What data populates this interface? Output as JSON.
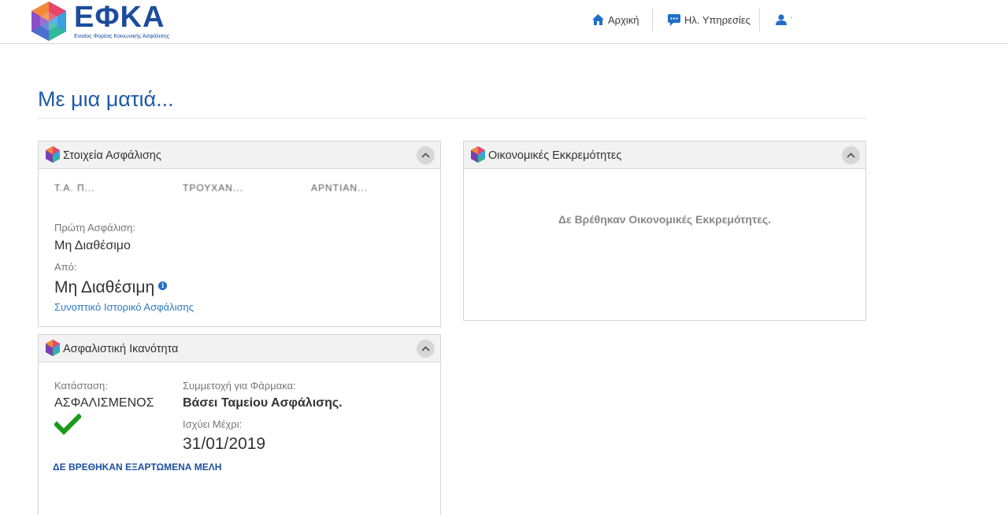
{
  "header": {
    "logo_text": "ΕΦΚΑ",
    "logo_subtitle": "Ενιαίος Φορέας Κοινωνικής Ασφάλισης",
    "nav": {
      "home": "Αρχική",
      "services": "Ηλ. Υπηρεσίες",
      "user": "'"
    }
  },
  "page": {
    "title": "Με μια ματιά..."
  },
  "insurance_panel": {
    "title": "Στοιχεία Ασφάλισης",
    "redacted": [
      "Τ.Α. Π...",
      "ΤΡΟΥΧΑΝ...",
      "ΑΡΝΤΙΑΝ..."
    ],
    "first_insurance_label": "Πρώτη Ασφάλιση:",
    "first_insurance_value": "Μη Διαθέσιμο",
    "from_label": "Από:",
    "from_value": "Μη Διαθέσιμη",
    "history_link": "Συνοπτικό Ιστορικό Ασφάλισης"
  },
  "finance_panel": {
    "title": "Οικονομικές Εκκρεμότητες",
    "empty_message": "Δε Βρέθηκαν Οικονομικές Εκκρεμότητες."
  },
  "capacity_panel": {
    "title": "Ασφαλιστική Ικανότητα",
    "status_label": "Κατάσταση:",
    "status_value": "ΑΣΦΑΛΙΣΜΕΝΟΣ",
    "drug_label": "Συμμετοχή για Φάρμακα:",
    "drug_value": "Βάσει Ταμείου Ασφάλισης.",
    "valid_label": "Ισχύει Μέχρι:",
    "valid_value": "31/01/2019",
    "dependents_link": "ΔΕ ΒΡΕΘΗΚΑΝ ΕΞΑΡΤΩΜΕΝΑ ΜΕΛΗ"
  },
  "colors": {
    "brand_blue": "#1c4d9c",
    "link_blue": "#2c7bc4",
    "check_green": "#1a9a1a"
  }
}
